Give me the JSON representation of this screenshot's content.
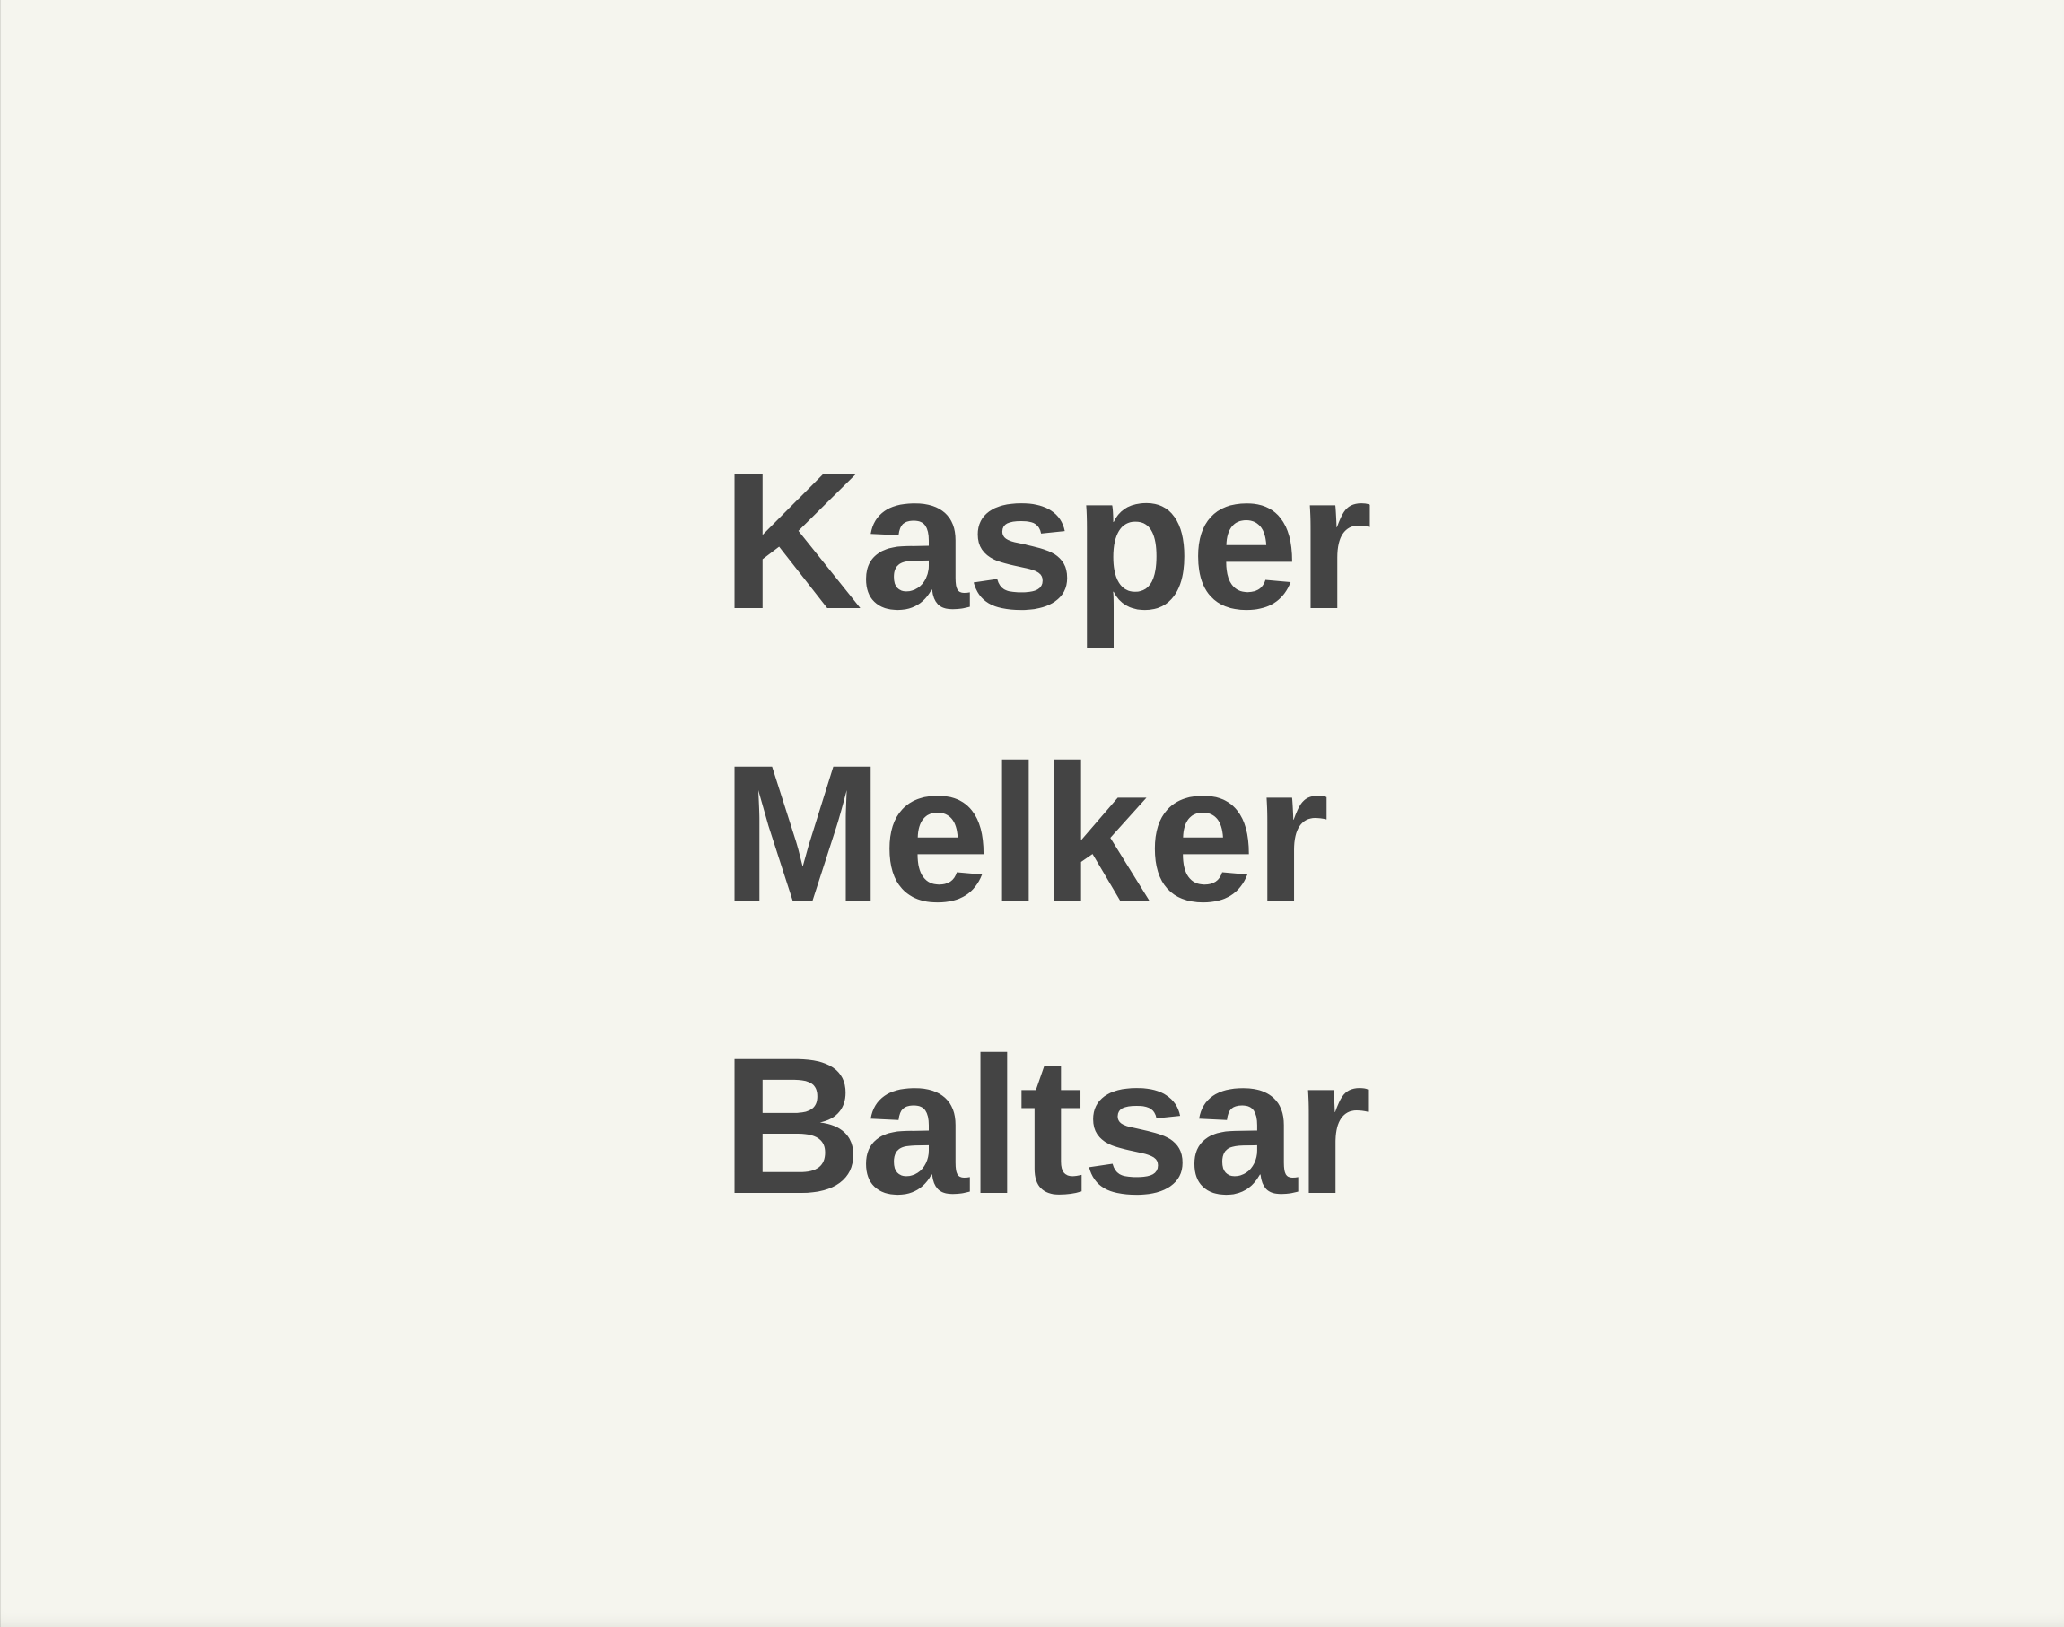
{
  "names": [
    "Kasper",
    "Melker",
    "Baltsar"
  ],
  "colors": {
    "background": "#f5f5ee",
    "text": "#444444"
  }
}
